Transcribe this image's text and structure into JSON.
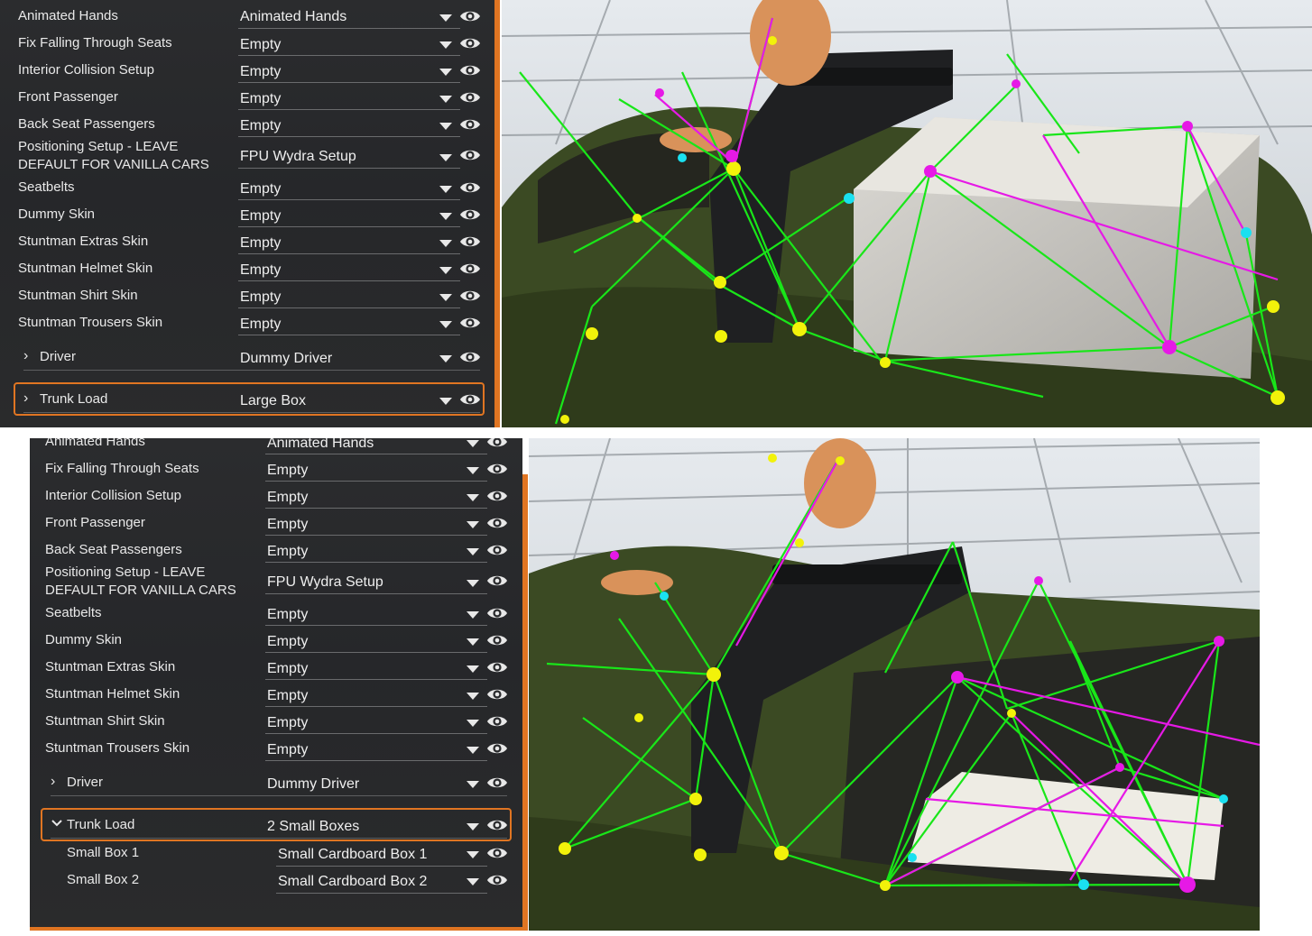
{
  "top_panel": {
    "rows": [
      {
        "label": "Animated Hands",
        "value": "Animated Hands"
      },
      {
        "label": "Fix Falling Through Seats",
        "value": "Empty"
      },
      {
        "label": "Interior Collision Setup",
        "value": "Empty"
      },
      {
        "label": "Front Passenger",
        "value": "Empty"
      },
      {
        "label": "Back Seat Passengers",
        "value": "Empty"
      },
      {
        "label_line1": "Positioning Setup - LEAVE",
        "label_line2": "DEFAULT FOR VANILLA CARS",
        "value": "FPU Wydra Setup"
      },
      {
        "label": "Seatbelts",
        "value": "Empty"
      },
      {
        "label": "Dummy Skin",
        "value": "Empty"
      },
      {
        "label": "Stuntman Extras Skin",
        "value": "Empty"
      },
      {
        "label": "Stuntman Helmet Skin",
        "value": "Empty"
      },
      {
        "label": "Stuntman Shirt Skin",
        "value": "Empty"
      },
      {
        "label": "Stuntman Trousers Skin",
        "value": "Empty"
      },
      {
        "label": "Driver",
        "value": "Dummy Driver"
      },
      {
        "label": "Trunk Load",
        "value": "Large Box"
      }
    ]
  },
  "bottom_panel": {
    "rows": [
      {
        "label": "Animated Hands",
        "value": "Animated Hands"
      },
      {
        "label": "Fix Falling Through Seats",
        "value": "Empty"
      },
      {
        "label": "Interior Collision Setup",
        "value": "Empty"
      },
      {
        "label": "Front Passenger",
        "value": "Empty"
      },
      {
        "label": "Back Seat Passengers",
        "value": "Empty"
      },
      {
        "label_line1": "Positioning Setup - LEAVE",
        "label_line2": "DEFAULT FOR VANILLA CARS",
        "value": "FPU Wydra Setup"
      },
      {
        "label": "Seatbelts",
        "value": "Empty"
      },
      {
        "label": "Dummy Skin",
        "value": "Empty"
      },
      {
        "label": "Stuntman Extras Skin",
        "value": "Empty"
      },
      {
        "label": "Stuntman Helmet Skin",
        "value": "Empty"
      },
      {
        "label": "Stuntman Shirt Skin",
        "value": "Empty"
      },
      {
        "label": "Stuntman Trousers Skin",
        "value": "Empty"
      },
      {
        "label": "Driver",
        "value": "Dummy Driver"
      },
      {
        "label": "Trunk Load",
        "value": "2 Small Boxes"
      },
      {
        "label": "Small Box 1",
        "value": "Small Cardboard Box 1"
      },
      {
        "label": "Small Box 2",
        "value": "Small Cardboard Box 2"
      }
    ]
  },
  "icons": {
    "dropdown": "chevron-down-icon",
    "visibility": "eye-icon",
    "collapsed": "chevron-right-icon",
    "expanded": "chevron-down-icon"
  },
  "colors": {
    "highlight": "#e07522",
    "panel_bg": "#28292b",
    "wire_green": "#19e619",
    "wire_magenta": "#e619e6",
    "node_yellow": "#f2f20a",
    "node_cyan": "#1ae0f0",
    "vehicle_olive": "#3c4a22"
  }
}
